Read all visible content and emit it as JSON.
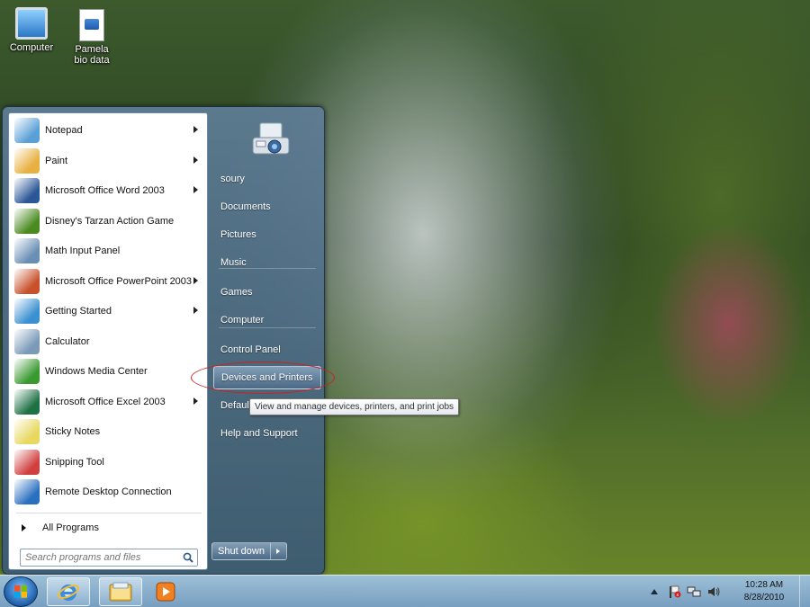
{
  "desktop": {
    "icons": [
      {
        "label": "Computer",
        "icon": "computer-icon"
      },
      {
        "label": "Pamela bio data",
        "icon": "word-document-icon"
      }
    ]
  },
  "start_menu": {
    "programs": [
      {
        "label": "Notepad",
        "icon": "notepad-icon",
        "has_submenu": true,
        "color": "#5aa0d8"
      },
      {
        "label": "Paint",
        "icon": "paint-palette-icon",
        "has_submenu": true,
        "color": "#e8b040"
      },
      {
        "label": "Microsoft Office Word 2003",
        "icon": "word-icon",
        "has_submenu": true,
        "color": "#2b5797"
      },
      {
        "label": "Disney's Tarzan Action Game",
        "icon": "tarzan-game-icon",
        "has_submenu": false,
        "color": "#4a8a20"
      },
      {
        "label": "Math Input Panel",
        "icon": "math-input-icon",
        "has_submenu": false,
        "color": "#6a8fb5"
      },
      {
        "label": "Microsoft Office PowerPoint 2003",
        "icon": "powerpoint-icon",
        "has_submenu": true,
        "color": "#c8502a"
      },
      {
        "label": "Getting Started",
        "icon": "getting-started-icon",
        "has_submenu": true,
        "color": "#3a90d0"
      },
      {
        "label": "Calculator",
        "icon": "calculator-icon",
        "has_submenu": false,
        "color": "#7a9ab8"
      },
      {
        "label": "Windows Media Center",
        "icon": "media-center-icon",
        "has_submenu": false,
        "color": "#3a9a30"
      },
      {
        "label": "Microsoft Office Excel 2003",
        "icon": "excel-icon",
        "has_submenu": true,
        "color": "#1e7145"
      },
      {
        "label": "Sticky Notes",
        "icon": "sticky-notes-icon",
        "has_submenu": false,
        "color": "#e8d860"
      },
      {
        "label": "Snipping Tool",
        "icon": "snipping-tool-icon",
        "has_submenu": false,
        "color": "#d04040"
      },
      {
        "label": "Remote Desktop Connection",
        "icon": "remote-desktop-icon",
        "has_submenu": false,
        "color": "#2a70c0"
      }
    ],
    "all_programs": "All Programs",
    "search_placeholder": "Search programs and files",
    "places": [
      {
        "label": "soury"
      },
      {
        "label": "Documents"
      },
      {
        "label": "Pictures"
      },
      {
        "label": "Music"
      },
      {
        "label": "Games"
      },
      {
        "label": "Computer"
      },
      {
        "label": "Control Panel"
      },
      {
        "label": "Devices and Printers",
        "hover": true
      },
      {
        "label": "Default"
      },
      {
        "label": "Help and Support"
      }
    ],
    "shutdown_label": "Shut down",
    "tooltip": "View and manage devices, printers, and print jobs",
    "annotation_color": "#d02020"
  },
  "taskbar": {
    "pinned": [
      "internet-explorer-icon",
      "windows-explorer-icon",
      "media-player-icon"
    ],
    "clock_time": "10:28 AM",
    "clock_date": "8/28/2010"
  }
}
